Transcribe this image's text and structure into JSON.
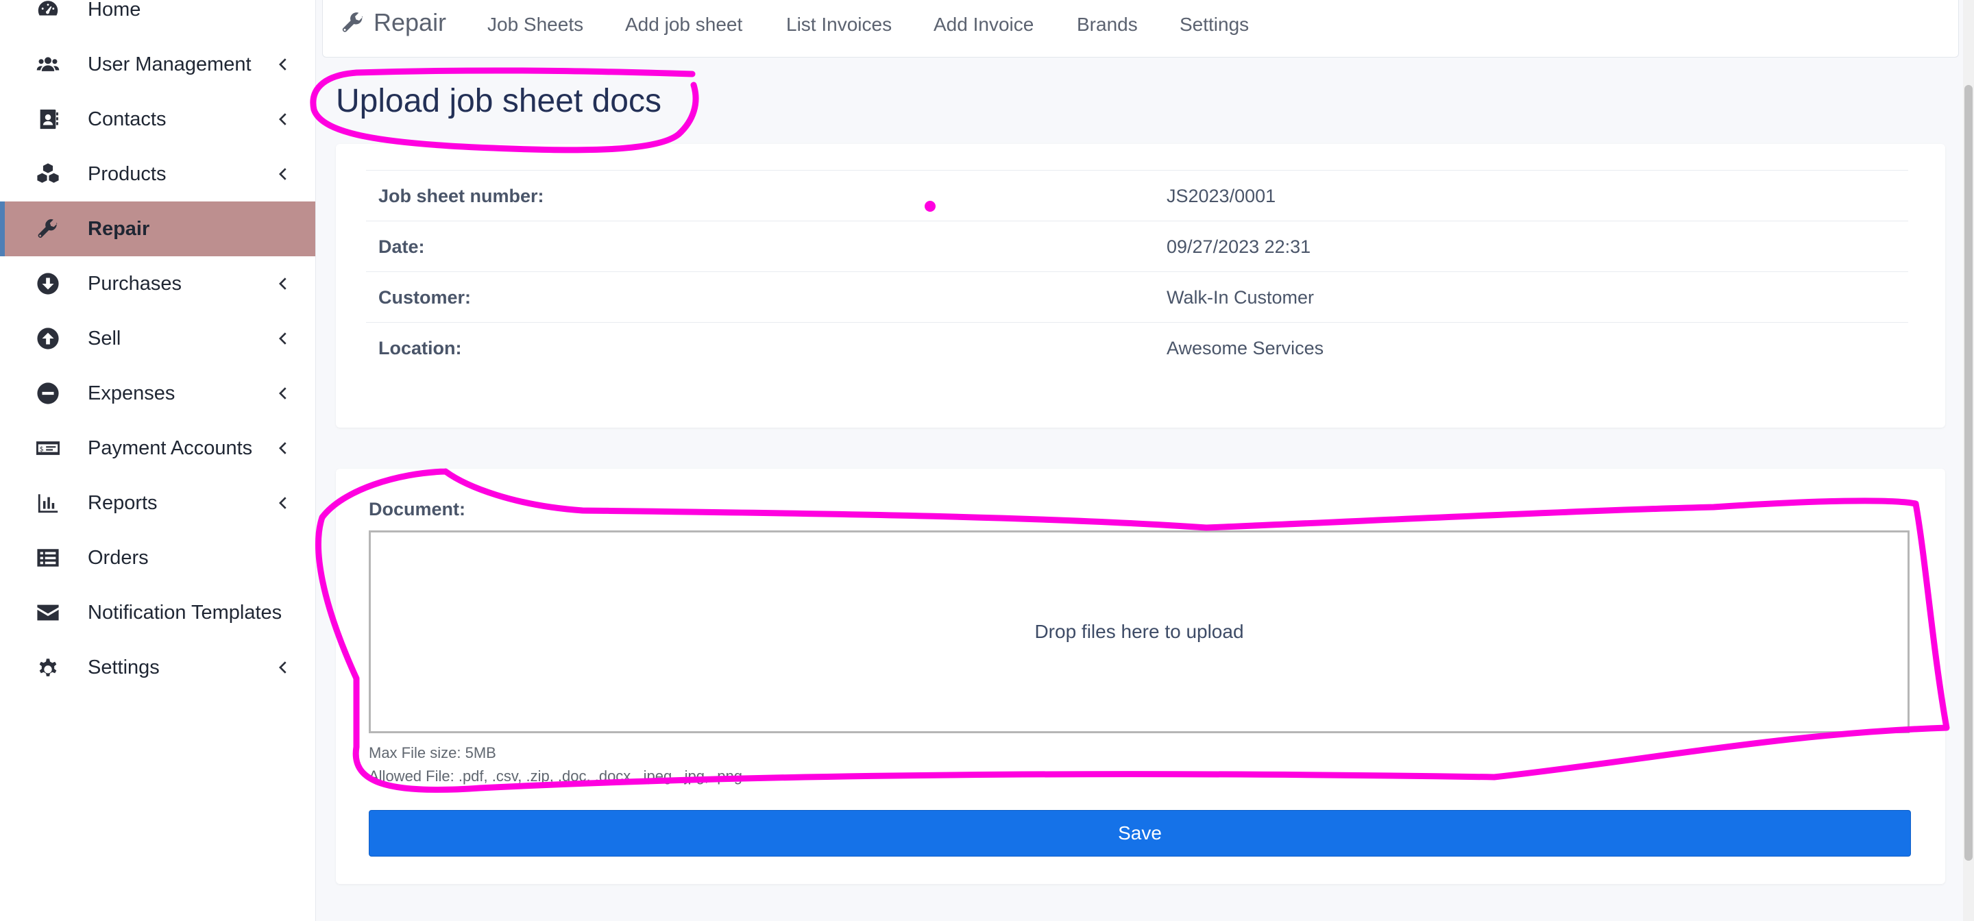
{
  "sidebar": {
    "items": [
      {
        "label": "Home",
        "icon": "gauge-icon",
        "chevron": false,
        "active": false
      },
      {
        "label": "User Management",
        "icon": "users-icon",
        "chevron": true,
        "active": false
      },
      {
        "label": "Contacts",
        "icon": "address-book-icon",
        "chevron": true,
        "active": false
      },
      {
        "label": "Products",
        "icon": "cubes-icon",
        "chevron": true,
        "active": false
      },
      {
        "label": "Repair",
        "icon": "wrench-icon",
        "chevron": false,
        "active": true
      },
      {
        "label": "Purchases",
        "icon": "arrow-circle-down-icon",
        "chevron": true,
        "active": false
      },
      {
        "label": "Sell",
        "icon": "arrow-circle-up-icon",
        "chevron": true,
        "active": false
      },
      {
        "label": "Expenses",
        "icon": "minus-circle-icon",
        "chevron": true,
        "active": false
      },
      {
        "label": "Payment Accounts",
        "icon": "money-check-icon",
        "chevron": true,
        "active": false
      },
      {
        "label": "Reports",
        "icon": "chart-bar-icon",
        "chevron": true,
        "active": false
      },
      {
        "label": "Orders",
        "icon": "list-icon",
        "chevron": false,
        "active": false
      },
      {
        "label": "Notification Templates",
        "icon": "envelope-icon",
        "chevron": false,
        "active": false
      },
      {
        "label": "Settings",
        "icon": "gear-icon",
        "chevron": true,
        "active": false
      }
    ]
  },
  "topnav": {
    "brand": "Repair",
    "links": [
      "Job Sheets",
      "Add job sheet",
      "List Invoices",
      "Add Invoice",
      "Brands",
      "Settings"
    ]
  },
  "page": {
    "title": "Upload job sheet docs"
  },
  "info": {
    "rows": [
      {
        "label": "Job sheet number:",
        "value": "JS2023/0001"
      },
      {
        "label": "Date:",
        "value": "09/27/2023 22:31"
      },
      {
        "label": "Customer:",
        "value": "Walk-In Customer"
      },
      {
        "label": "Location:",
        "value": "Awesome Services"
      }
    ]
  },
  "upload": {
    "label": "Document:",
    "dropzone_text": "Drop files here to upload",
    "max_size": "Max File size: 5MB",
    "allowed": "Allowed File: .pdf, .csv, .zip, .doc, .docx, .jpeg, .jpg, .png",
    "save_label": "Save"
  },
  "colors": {
    "accent": "#1572e8",
    "active_nav": "#bd8f8f",
    "annotation": "#ff00e0"
  }
}
